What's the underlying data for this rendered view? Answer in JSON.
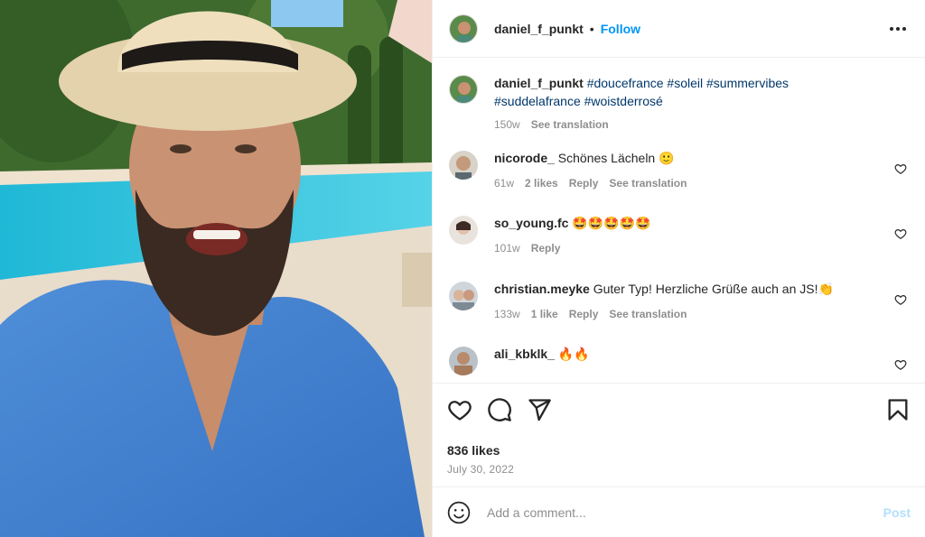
{
  "post": {
    "username": "daniel_f_punkt",
    "separator": "•",
    "follow_label": "Follow",
    "caption": {
      "username": "daniel_f_punkt",
      "tags_line1": "#doucefrance #soleil #summervibes",
      "tags_line2": "#suddelafrance #woistderrosé",
      "time": "150w",
      "translate_label": "See translation"
    },
    "likes": "836 likes",
    "date": "July 30, 2022"
  },
  "comments": [
    {
      "user": "nicorode_",
      "text": "Schönes Lächeln 🙂",
      "time": "61w",
      "likes": "2 likes",
      "reply": "Reply",
      "translate": "See translation"
    },
    {
      "user": "so_young.fc",
      "text": "🤩🤩🤩🤩🤩",
      "time": "101w",
      "reply": "Reply"
    },
    {
      "user": "christian.meyke",
      "text": "Guter Typ! Herzliche Grüße auch an JS!👏",
      "time": "133w",
      "likes": "1 like",
      "reply": "Reply",
      "translate": "See translation"
    },
    {
      "user": "ali_kbklk_",
      "text": "🔥🔥"
    }
  ],
  "add_comment": {
    "placeholder": "Add a comment...",
    "post_label": "Post"
  },
  "icons": {
    "like": "heart-icon",
    "comment": "comment-icon",
    "share": "share-icon",
    "save": "bookmark-icon",
    "emoji": "emoji-icon",
    "more": "more-options-icon"
  },
  "colors": {
    "follow": "#0095f6",
    "hashtag": "#00376b",
    "post_disabled": "#b2dffc",
    "muted": "#8e8e8e"
  }
}
